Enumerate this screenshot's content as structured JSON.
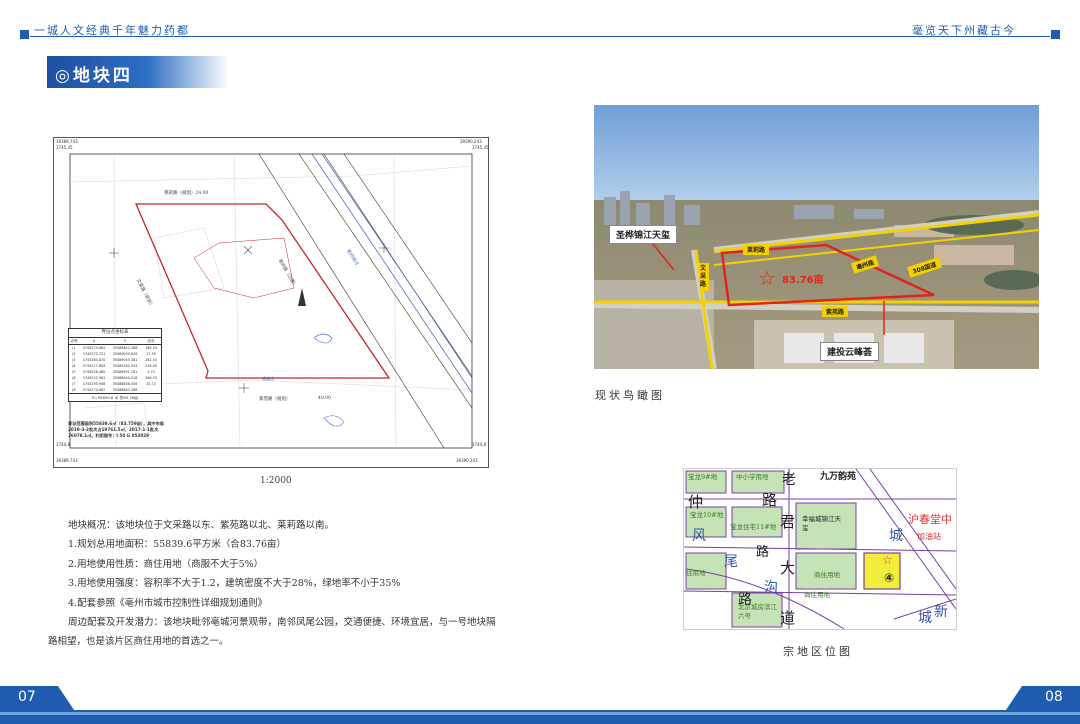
{
  "header": {
    "left_text": "一城人文经典千年魅力药都",
    "right_text": "毫览天下州藏古今"
  },
  "section_title": "◎地块四",
  "cadastral_map": {
    "corner_tl": "39389,743",
    "corner_tr": "39390,243",
    "corner_ml": "3745,35",
    "corner_mr": "3745,35",
    "corner_bl": "39389,743",
    "corner_br": "39390,243",
    "corner_lbl": "3744,8",
    "corner_lbr": "3744,8",
    "road_top": "莱莉路（规划）24.00",
    "road_left": "文采路（规划）",
    "road_bottom": "紫苑路（规划）",
    "road_bottom_width": "40.00",
    "road_right": "亳州路（已建）",
    "river": "亳州城河",
    "rail": "铁路线",
    "table_title": "界址点坐标表",
    "table_headers": [
      "点号",
      "X",
      "Y",
      "边长"
    ],
    "table_rows": [
      [
        "J1",
        "3745274.682",
        "39388842.388",
        "188.24"
      ],
      [
        "J2",
        "3745272.721",
        "39389030.626",
        "17.39"
      ],
      [
        "J3",
        "3745263.870",
        "39389045.381",
        "281.53"
      ],
      [
        "J4",
        "3745017.854",
        "39389181.934",
        "228.09"
      ],
      [
        "J5",
        "3745026.465",
        "39388951.761",
        "5.70"
      ],
      [
        "J6",
        "3745022.561",
        "39388940.018",
        "286.33"
      ],
      [
        "J7",
        "3745295.908",
        "39388838.456",
        "10.72"
      ],
      [
        "J8",
        "3745274.682",
        "39388842.388",
        ""
      ]
    ],
    "table_total": "S=55839.6 ㎡ 合83.76亩",
    "note": "界址范围面积55839.6㎡（83.759亩），其中市局2019-3-2批次占19761.5㎡，2017-1-1批次36078.1㎡。利用图号：I 50 G 053029"
  },
  "scale_label": "1:2000",
  "description": {
    "overview": "地块概况：该地块位于文采路以东、紫苑路以北、莱莉路以南。",
    "items": [
      "1.规划总用地面积：55839.6平方米（合83.76亩）",
      "2.用地使用性质：商住用地（商服不大于5%）",
      "3.用地使用强度：容积率不大于1.2，建筑密度不大于28%，绿地率不小于35%",
      "4.配套参照《亳州市城市控制性详细规划通则》"
    ],
    "surroundings": "周边配套及开发潜力：该地块毗邻亳城河景观带，南邻凤尾公园，交通便捷、环境宜居，与一号地块隔路相望，也是该片区商住用地的首选之一。"
  },
  "aerial": {
    "caption": "现状鸟瞰图",
    "labels": {
      "project1": "圣桦锦江天玺",
      "project2": "建投云峰荟",
      "road_top": "莱莉路",
      "road_bottom": "紫苑路",
      "road_left": "文采路",
      "road_diag1": "亳州路",
      "road_diag2": "308国道",
      "area": "83.76亩"
    }
  },
  "location_map": {
    "caption": "宗地区位图",
    "labels": {
      "top1": "宝龙9#地",
      "top2": "中小学用地",
      "top3": "老",
      "top4": "九万韵苑",
      "road1": "仲",
      "road2": "路",
      "l1": "宝龙10#地",
      "l2": "宝龙住宅11#地",
      "l3": "君",
      "l4": "幸福城锦江天玺",
      "l5": "城",
      "l6": "沪春堂中",
      "l7": "加油站",
      "l8": "风",
      "l9": "尾",
      "l10": "路",
      "l11": "大",
      "l12": "住用地",
      "l13": "商住用地",
      "l14": "沟",
      "l15": "路",
      "l16": "北京城房滨江六号",
      "l17": "道",
      "l18": "城",
      "l19": "新",
      "l20": "商住用地",
      "plot": "④"
    }
  },
  "footer": {
    "left_page": "07",
    "right_page": "08"
  }
}
